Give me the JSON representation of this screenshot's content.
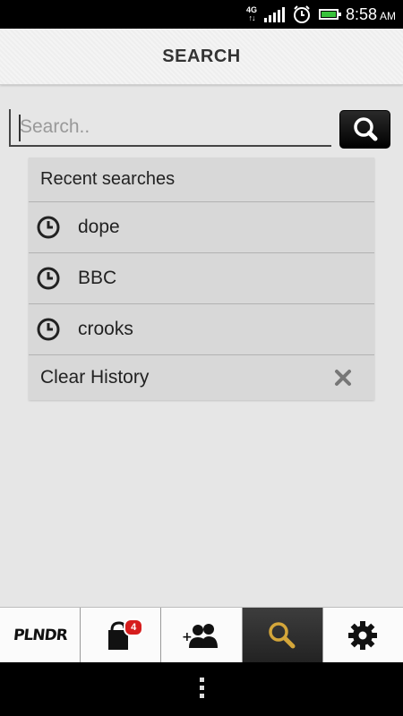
{
  "status_bar": {
    "network": "4G",
    "time": "8:58",
    "ampm": "AM",
    "icons": [
      "network-4g-icon",
      "signal-icon",
      "alarm-icon",
      "battery-icon"
    ]
  },
  "header": {
    "title": "SEARCH"
  },
  "search": {
    "placeholder": "Search..",
    "value": ""
  },
  "recent": {
    "header": "Recent searches",
    "items": [
      {
        "label": "dope",
        "icon": "clock-icon"
      },
      {
        "label": "BBC",
        "icon": "clock-icon"
      },
      {
        "label": "crooks",
        "icon": "clock-icon"
      }
    ],
    "clear_label": "Clear History"
  },
  "tabs": [
    {
      "name": "logo",
      "label": "PLNDR",
      "icon": "logo-icon"
    },
    {
      "name": "bag",
      "icon": "shopping-bag-icon",
      "badge": "4"
    },
    {
      "name": "friends",
      "icon": "add-friends-icon"
    },
    {
      "name": "search",
      "icon": "search-icon",
      "active": true
    },
    {
      "name": "settings",
      "icon": "gear-icon"
    }
  ],
  "colors": {
    "active_tab": "#2e2e2e",
    "search_icon_active": "#d4a63a",
    "badge": "#d61d1d"
  }
}
